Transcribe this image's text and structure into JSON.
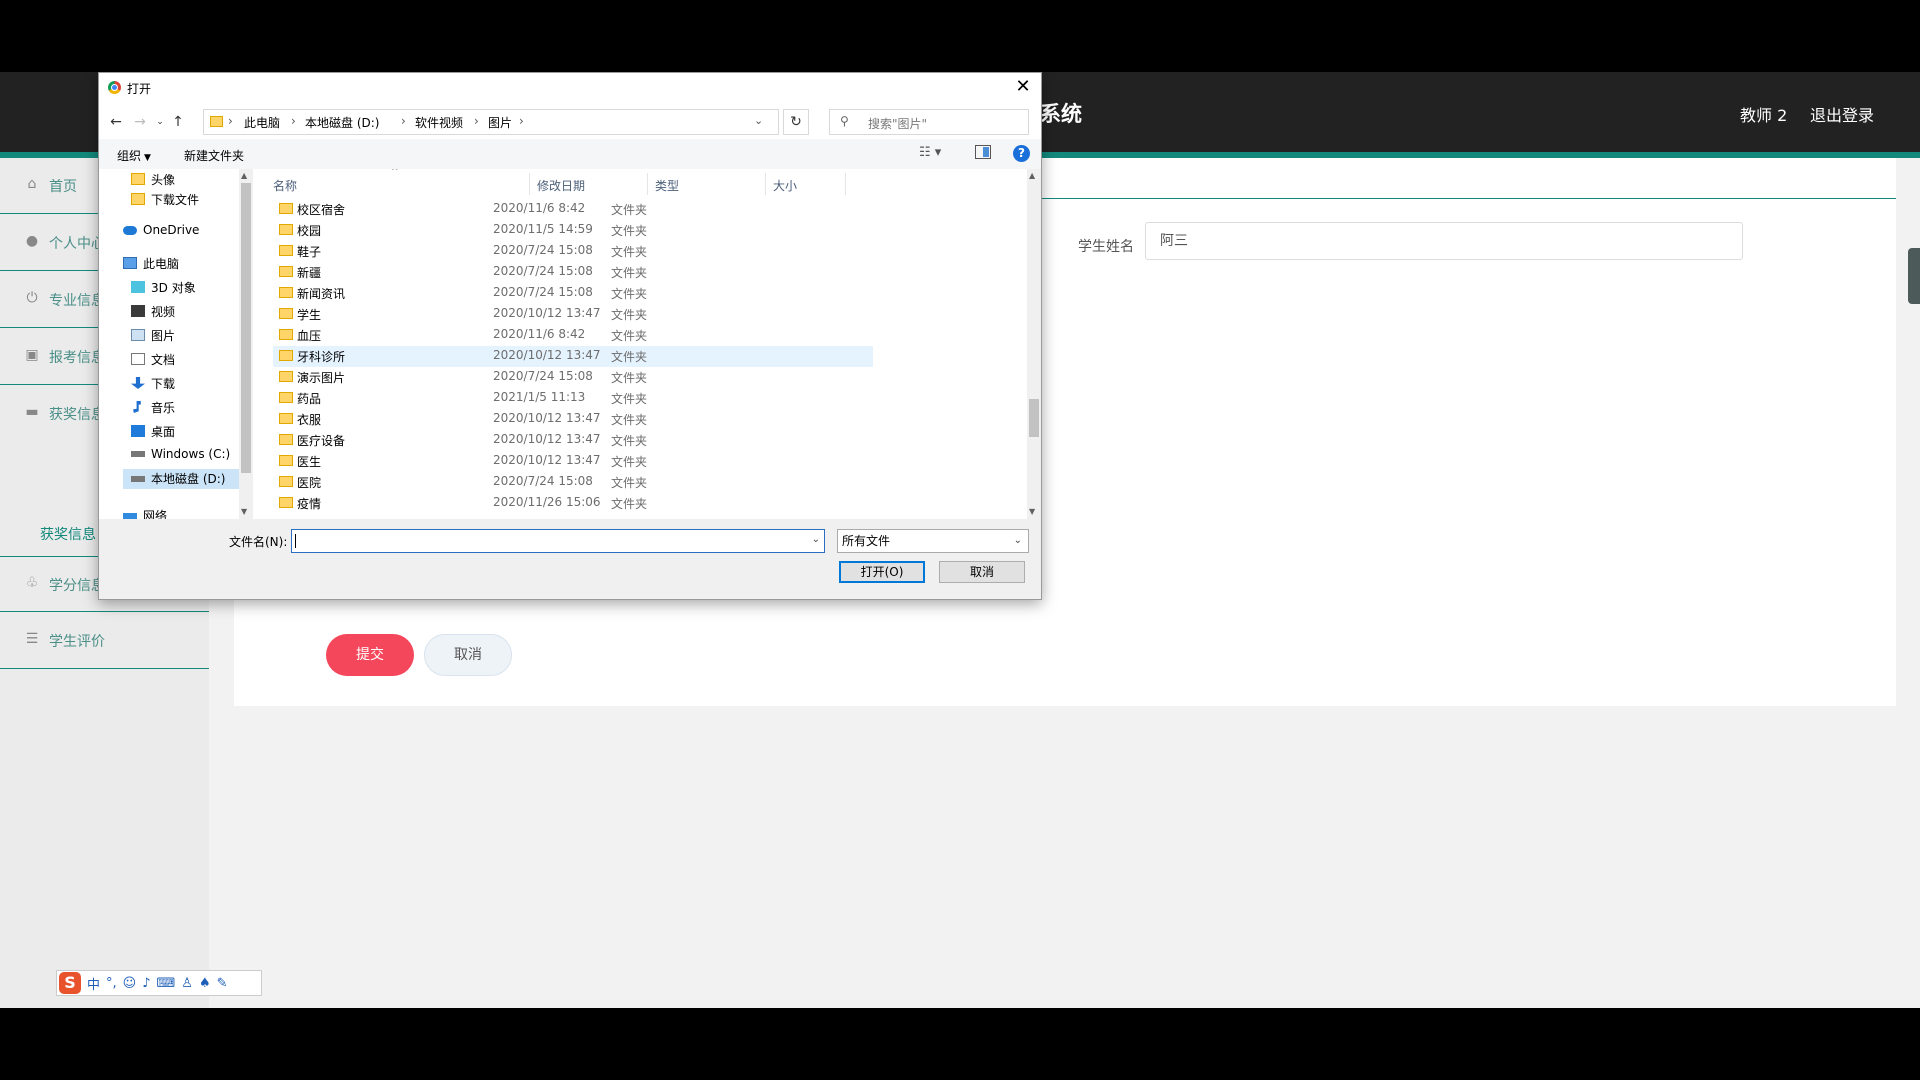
{
  "app": {
    "title": "系统",
    "user": "教师 2",
    "logout": "退出登录",
    "sidebar": [
      {
        "label": "首页",
        "icon": "home-icon"
      },
      {
        "label": "个人中心",
        "icon": "user-icon"
      },
      {
        "label": "专业信息",
        "icon": "power-icon"
      },
      {
        "label": "报考信息",
        "icon": "delete-icon"
      },
      {
        "label": "获奖信息",
        "icon": "print-icon"
      },
      {
        "label": "学分信息",
        "icon": "bell-icon"
      },
      {
        "label": "学生评价",
        "icon": "sliders-icon"
      }
    ],
    "sidebar_sub": "获奖信息",
    "form": {
      "student_name_label": "学生姓名",
      "student_name_value": "阿三",
      "submit": "提交",
      "cancel": "取消"
    }
  },
  "dialog": {
    "title": "打开",
    "breadcrumbs": [
      "此电脑",
      "本地磁盘 (D:)",
      "软件视频",
      "图片"
    ],
    "search_placeholder": "搜索\"图片\"",
    "organize": "组织",
    "new_folder": "新建文件夹",
    "nav": [
      {
        "label": "头像",
        "icon": "folder-icon"
      },
      {
        "label": "下载文件",
        "icon": "folder-icon"
      },
      {
        "label": "OneDrive",
        "icon": "cloud-icon"
      },
      {
        "label": "此电脑",
        "icon": "computer-icon"
      },
      {
        "label": "3D 对象",
        "icon": "3d-objects-icon"
      },
      {
        "label": "视频",
        "icon": "video-icon"
      },
      {
        "label": "图片",
        "icon": "pictures-icon"
      },
      {
        "label": "文档",
        "icon": "documents-icon"
      },
      {
        "label": "下载",
        "icon": "download-icon"
      },
      {
        "label": "音乐",
        "icon": "music-icon"
      },
      {
        "label": "桌面",
        "icon": "desktop-icon"
      },
      {
        "label": "Windows (C:)",
        "icon": "drive-icon"
      },
      {
        "label": "本地磁盘 (D:)",
        "icon": "drive-icon"
      },
      {
        "label": "网络",
        "icon": "network-icon"
      }
    ],
    "columns": [
      "名称",
      "修改日期",
      "类型",
      "大小"
    ],
    "files": [
      {
        "name": "校区宿舍",
        "date": "2020/11/6 8:42",
        "type": "文件夹"
      },
      {
        "name": "校园",
        "date": "2020/11/5 14:59",
        "type": "文件夹"
      },
      {
        "name": "鞋子",
        "date": "2020/7/24 15:08",
        "type": "文件夹"
      },
      {
        "name": "新疆",
        "date": "2020/7/24 15:08",
        "type": "文件夹"
      },
      {
        "name": "新闻资讯",
        "date": "2020/7/24 15:08",
        "type": "文件夹"
      },
      {
        "name": "学生",
        "date": "2020/10/12 13:47",
        "type": "文件夹"
      },
      {
        "name": "血压",
        "date": "2020/11/6 8:42",
        "type": "文件夹"
      },
      {
        "name": "牙科诊所",
        "date": "2020/10/12 13:47",
        "type": "文件夹"
      },
      {
        "name": "演示图片",
        "date": "2020/7/24 15:08",
        "type": "文件夹"
      },
      {
        "name": "药品",
        "date": "2021/1/5 11:13",
        "type": "文件夹"
      },
      {
        "name": "衣服",
        "date": "2020/10/12 13:47",
        "type": "文件夹"
      },
      {
        "name": "医疗设备",
        "date": "2020/10/12 13:47",
        "type": "文件夹"
      },
      {
        "name": "医生",
        "date": "2020/10/12 13:47",
        "type": "文件夹"
      },
      {
        "name": "医院",
        "date": "2020/7/24 15:08",
        "type": "文件夹"
      },
      {
        "name": "疫情",
        "date": "2020/11/26 15:06",
        "type": "文件夹"
      }
    ],
    "filename_label": "文件名(N):",
    "filename_value": "",
    "filetype": "所有文件",
    "open": "打开(O)",
    "cancel": "取消"
  },
  "ime": {
    "label": "中"
  }
}
